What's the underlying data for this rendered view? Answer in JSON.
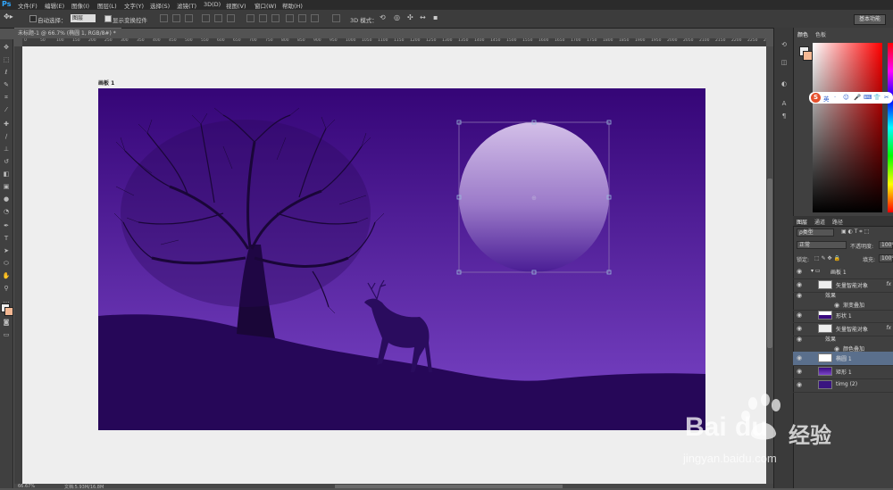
{
  "menubar": {
    "logo": "Ps",
    "items": [
      "文件(F)",
      "编辑(E)",
      "图像(I)",
      "图层(L)",
      "文字(Y)",
      "选择(S)",
      "滤镜(T)",
      "3D(D)",
      "视图(V)",
      "窗口(W)",
      "帮助(H)"
    ]
  },
  "options": {
    "auto_select_label": "自动选择：",
    "auto_select_value": "图层",
    "show_transform_label": "显示变换控件",
    "mode_3d_label": "3D 模式：",
    "workspace": "基本功能"
  },
  "document": {
    "tab_title": "未标题-1 @ 66.7% (椭圆 1, RGB/8#) *",
    "artboard_label": "画板 1"
  },
  "ruler_ticks": [
    "0",
    "50",
    "100",
    "150",
    "200",
    "250",
    "300",
    "350",
    "400",
    "450",
    "500",
    "550",
    "600",
    "650",
    "700",
    "750",
    "800",
    "850",
    "900",
    "950",
    "1000",
    "1050",
    "1100",
    "1150",
    "1200",
    "1250",
    "1300",
    "1350",
    "1400",
    "1450",
    "1500",
    "1550",
    "1600",
    "1650",
    "1700",
    "1750",
    "1800",
    "1850",
    "1900",
    "1950",
    "2000",
    "2050",
    "2100",
    "2150",
    "2200",
    "2250",
    "2300"
  ],
  "status": {
    "zoom": "66.67%",
    "doc": "文档:5.93M/16.8M"
  },
  "color_panel": {
    "tabs": [
      "颜色",
      "色板"
    ],
    "fg_color": "#eeeeee",
    "bg_color": "#f4b893"
  },
  "ime": {
    "label": "英",
    "icons": [
      "·",
      "☺",
      "🎤",
      "⌨",
      "👕",
      "✂"
    ]
  },
  "layers_panel": {
    "tabs": [
      "图层",
      "通道",
      "路径"
    ],
    "filter_label": "ρ类型",
    "blend_mode": "正常",
    "opacity_label": "不透明度:",
    "opacity_value": "100%",
    "lock_label": "锁定:",
    "fill_label": "填充:",
    "fill_value": "100%",
    "layers": [
      {
        "name": "画板 1",
        "type": "group"
      },
      {
        "name": "矢量智能对象",
        "type": "smart",
        "fx": "fx"
      },
      {
        "name": "效果",
        "type": "effect-header"
      },
      {
        "name": "渐变叠加",
        "type": "effect"
      },
      {
        "name": "形状 1",
        "type": "shape"
      },
      {
        "name": "矢量智能对象",
        "type": "smart",
        "fx": "fx"
      },
      {
        "name": "效果",
        "type": "effect-header"
      },
      {
        "name": "颜色叠加",
        "type": "effect"
      },
      {
        "name": "椭圆 1",
        "type": "ellipse",
        "selected": true
      },
      {
        "name": "矩形 1",
        "type": "rect"
      },
      {
        "name": "timg (2)",
        "type": "image"
      }
    ]
  },
  "colors": {
    "sky_top": "#350577",
    "sky_bottom": "#7b46c8",
    "ground": "#260758",
    "moon_top": "#d3bfe8",
    "moon_bottom": "#4a1d95"
  },
  "watermark": {
    "brand": "Bai",
    "brand2": "du",
    "cn": "经验",
    "url": "jingyan.baidu.com"
  }
}
